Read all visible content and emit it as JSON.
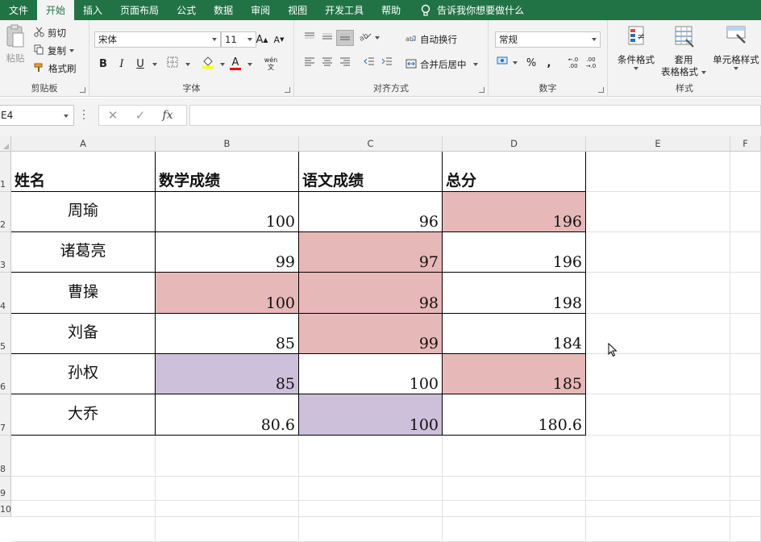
{
  "ribbon_tabs": [
    "文件",
    "开始",
    "插入",
    "页面布局",
    "公式",
    "数据",
    "审阅",
    "视图",
    "开发工具",
    "帮助"
  ],
  "active_tab_index": 1,
  "tell_me": "告诉我你想要做什么",
  "clipboard": {
    "paste": "粘贴",
    "cut": "剪切",
    "copy": "复制",
    "format_painter": "格式刷",
    "label": "剪贴板"
  },
  "font": {
    "name": "宋体",
    "size": "11",
    "bold": "B",
    "italic": "I",
    "underline": "U",
    "font_color_glyph": "A",
    "wen_glyph": "wén 文",
    "grow_glyph": "A",
    "shrink_glyph": "A",
    "label": "字体"
  },
  "alignment": {
    "wrap_text": "自动换行",
    "merge_center": "合并后居中",
    "label": "对齐方式"
  },
  "number": {
    "format": "常规",
    "percent": "%",
    "comma": ",",
    "inc_dec": "←.0 .00",
    "dec_dec": ".00 →.0",
    "label": "数字"
  },
  "styles": {
    "conditional": "条件格式",
    "table_line1": "套用",
    "table_line2": "表格格式",
    "cell_styles": "单元格样式",
    "label": "样式"
  },
  "formula_bar": {
    "name_box": "E4",
    "cancel": "✕",
    "enter": "✓",
    "fx": "fx",
    "content": ""
  },
  "columns": [
    "A",
    "B",
    "C",
    "D",
    "E",
    "F"
  ],
  "rows": [
    "1",
    "2",
    "3",
    "4",
    "5",
    "6",
    "7",
    "8",
    "9",
    "10"
  ],
  "colors": {
    "accent": "#217346",
    "pink_fill": "#e6b8b7",
    "purple_fill": "#ccc0da"
  },
  "table": {
    "headers": [
      "姓名",
      "数学成绩",
      "语文成绩",
      "总分"
    ],
    "rows": [
      {
        "name": "周瑜",
        "math": "100",
        "chinese": "96",
        "total": "196"
      },
      {
        "name": "诸葛亮",
        "math": "99",
        "chinese": "97",
        "total": "196"
      },
      {
        "name": "曹操",
        "math": "100",
        "chinese": "98",
        "total": "198"
      },
      {
        "name": "刘备",
        "math": "85",
        "chinese": "99",
        "total": "184"
      },
      {
        "name": "孙权",
        "math": "85",
        "chinese": "100",
        "total": "185"
      },
      {
        "name": "大乔",
        "math": "80.6",
        "chinese": "100",
        "total": "180.6"
      }
    ],
    "fills": [
      [
        "",
        "",
        "",
        "pink"
      ],
      [
        "",
        "",
        "pink",
        ""
      ],
      [
        "",
        "pink",
        "pink",
        ""
      ],
      [
        "",
        "",
        "pink",
        ""
      ],
      [
        "",
        "purple",
        "",
        "pink"
      ],
      [
        "",
        "",
        "purple",
        ""
      ]
    ]
  }
}
